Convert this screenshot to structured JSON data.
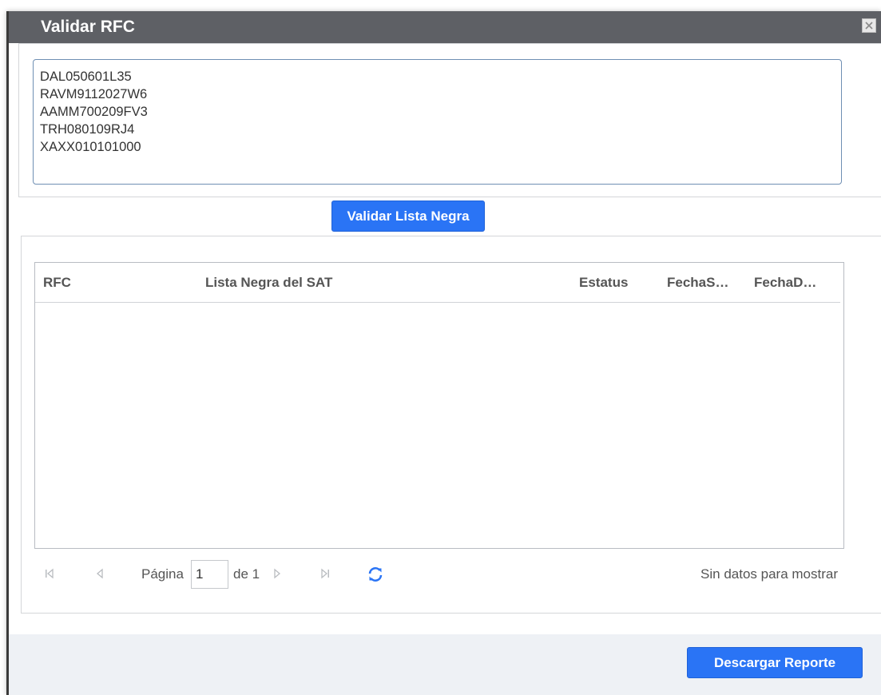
{
  "dialog": {
    "title": "Validar RFC"
  },
  "rfc_input": {
    "value": "DAL050601L35\nRAVM9112027W6\nAAMM700209FV3\nTRH080109RJ4\nXAXX010101000"
  },
  "validate_button": {
    "label": "Validar Lista Negra"
  },
  "grid": {
    "columns": [
      "RFC",
      "Lista Negra del SAT",
      "Estatus",
      "FechaS…",
      "FechaD…"
    ],
    "rows": []
  },
  "pager": {
    "page_label": "Página",
    "current_page": "1",
    "of_label": "de 1",
    "empty_message": "Sin datos para mostrar"
  },
  "download_button": {
    "label": "Descargar Reporte"
  },
  "colors": {
    "titlebar": "#5e6065",
    "primary_button": "#2a74f5",
    "refresh_icon": "#2a74f5",
    "footer_bg": "#eef1f5"
  },
  "icons": [
    "close-icon",
    "first-page-icon",
    "prev-page-icon",
    "next-page-icon",
    "last-page-icon",
    "refresh-icon"
  ]
}
